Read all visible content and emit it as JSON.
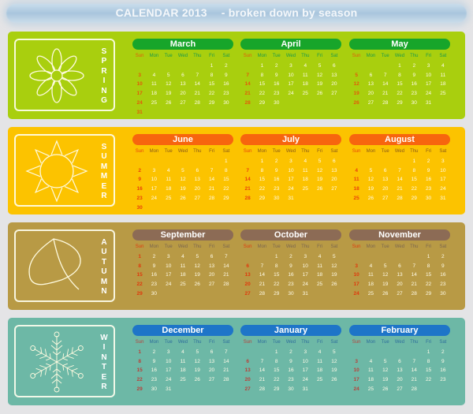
{
  "title": {
    "part1": "CALENDAR  2013",
    "part2": "-  broken down by season"
  },
  "weekdays": [
    "Sun",
    "Mon",
    "Tue",
    "Wed",
    "Thu",
    "Fri",
    "Sat"
  ],
  "seasons": [
    {
      "name": "spring",
      "label": "SPRING",
      "icon": "flower-icon",
      "colors": {
        "panel": "#a9cf0e",
        "header": "#17a52a",
        "dow": "#1c9a4a",
        "sun": "#e35a0a"
      },
      "months": [
        {
          "name": "March",
          "start": 5,
          "days": 31
        },
        {
          "name": "April",
          "start": 1,
          "days": 30
        },
        {
          "name": "May",
          "start": 3,
          "days": 31
        }
      ]
    },
    {
      "name": "summer",
      "label": "SUMMER",
      "icon": "sun-icon",
      "colors": {
        "panel": "#fcc300",
        "header": "#f7650e",
        "dow": "#8a5a18",
        "sun": "#e8420c"
      },
      "months": [
        {
          "name": "June",
          "start": 6,
          "days": 30
        },
        {
          "name": "July",
          "start": 1,
          "days": 31
        },
        {
          "name": "August",
          "start": 4,
          "days": 31
        }
      ]
    },
    {
      "name": "autumn",
      "label": "AUTUMN",
      "icon": "leaf-icon",
      "colors": {
        "panel": "#b89a45",
        "header": "#8c6b55",
        "dow": "#7a6650",
        "sun": "#e0380c"
      },
      "months": [
        {
          "name": "September",
          "start": 0,
          "days": 30
        },
        {
          "name": "October",
          "start": 2,
          "days": 31
        },
        {
          "name": "November",
          "start": 5,
          "days": 30
        }
      ]
    },
    {
      "name": "winter",
      "label": "WINTER",
      "icon": "snowflake-icon",
      "colors": {
        "panel": "#6db8a6",
        "header": "#1e75c8",
        "dow": "#2e6e9c",
        "sun": "#b8403a"
      },
      "months": [
        {
          "name": "December",
          "start": 0,
          "days": 31
        },
        {
          "name": "January",
          "start": 2,
          "days": 31
        },
        {
          "name": "February",
          "start": 5,
          "days": 28
        }
      ]
    }
  ]
}
